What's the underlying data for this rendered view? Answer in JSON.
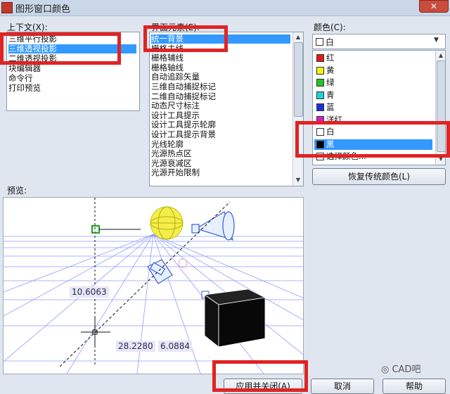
{
  "window": {
    "title": "图形窗口颜色",
    "close_glyph": "✕"
  },
  "context": {
    "label": "上下文(X):",
    "items": [
      {
        "text": "三维平行投影",
        "selected": false
      },
      {
        "text": "三维透视投影",
        "selected": true
      },
      {
        "text": "二维透视投影",
        "selected": false
      },
      {
        "text": "块编辑器",
        "selected": false
      },
      {
        "text": "命令行",
        "selected": false
      },
      {
        "text": "打印预览",
        "selected": false
      }
    ]
  },
  "interface": {
    "label": "界面元素(E):",
    "items": [
      {
        "text": "统一背景",
        "selected": true
      },
      {
        "text": "栅格主线",
        "selected": false
      },
      {
        "text": "栅格辅线",
        "selected": false
      },
      {
        "text": "栅格轴线",
        "selected": false
      },
      {
        "text": "自动追踪矢量",
        "selected": false
      },
      {
        "text": "三维自动捕捉标记",
        "selected": false
      },
      {
        "text": "二维自动捕捉标记",
        "selected": false
      },
      {
        "text": "动态尺寸标注",
        "selected": false
      },
      {
        "text": "设计工具提示",
        "selected": false
      },
      {
        "text": "设计工具提示轮廓",
        "selected": false
      },
      {
        "text": "设计工具提示背景",
        "selected": false
      },
      {
        "text": "光线轮廓",
        "selected": false
      },
      {
        "text": "光源热点区",
        "selected": false
      },
      {
        "text": "光源衰减区",
        "selected": false
      },
      {
        "text": "光源开始限制",
        "selected": false
      }
    ]
  },
  "color": {
    "label": "颜色(C):",
    "current": "白",
    "options": [
      {
        "name": "红",
        "color": "#e01b1b",
        "selected": false
      },
      {
        "name": "黄",
        "color": "#f2f21c",
        "selected": false
      },
      {
        "name": "绿",
        "color": "#22c522",
        "selected": false
      },
      {
        "name": "青",
        "color": "#1fd2d2",
        "selected": false
      },
      {
        "name": "蓝",
        "color": "#1f2fe0",
        "selected": false
      },
      {
        "name": "洋红",
        "color": "#d11fd1",
        "selected": false
      },
      {
        "name": "白",
        "color": "#ffffff",
        "selected": false
      },
      {
        "name": "黑",
        "color": "#000000",
        "selected": true
      },
      {
        "name": "选择颜色...",
        "color": "#ffffff",
        "selected": false
      }
    ],
    "restore_button": "恢复传统颜色(L)"
  },
  "preview": {
    "label": "预览:",
    "dimensions": [
      "10.6063",
      "28.2280",
      "6.0884"
    ]
  },
  "watermark": "CAD吧",
  "buttons": {
    "apply_close": "应用并关闭(A)",
    "cancel": "取消",
    "help": "帮助"
  },
  "accent_colors": {
    "selection": "#3399ff",
    "highlight_frame": "#e02323",
    "preview_grid": "#6a7cff"
  }
}
